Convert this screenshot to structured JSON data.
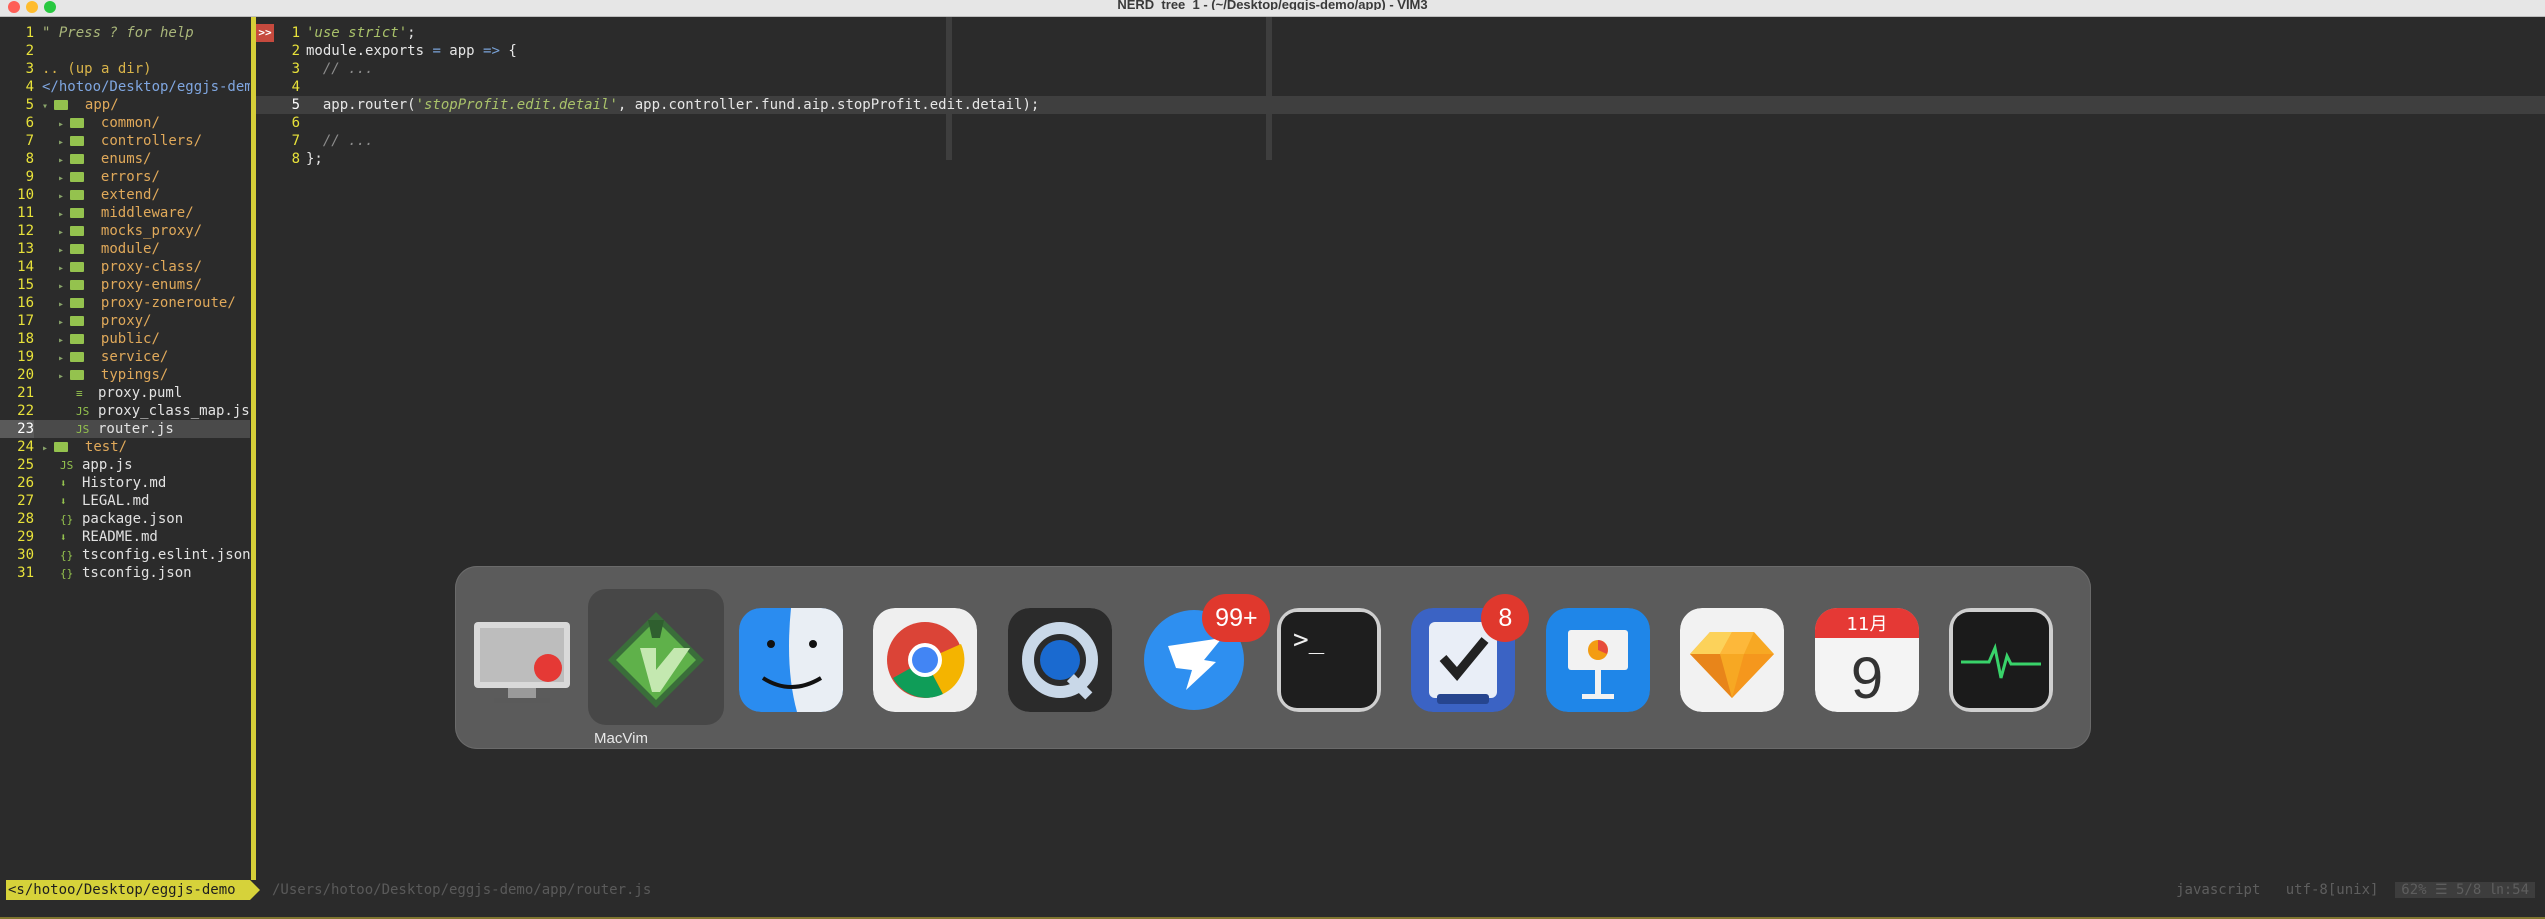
{
  "window": {
    "title": "NERD_tree_1 - (~/Desktop/eggjs-demo/app) - VIM3"
  },
  "nerdtree": {
    "lines": [
      {
        "n": "1",
        "text": "\" Press ? for help",
        "kind": "help"
      },
      {
        "n": "2",
        "text": "",
        "kind": "blank"
      },
      {
        "n": "3",
        "text": ".. (up a dir)",
        "kind": "updir"
      },
      {
        "n": "4",
        "text": "</hotoo/Desktop/eggjs-demo/",
        "kind": "root"
      },
      {
        "n": "5",
        "text": "app/",
        "kind": "dir",
        "depth": 1,
        "open": true
      },
      {
        "n": "6",
        "text": "common/",
        "kind": "dir",
        "depth": 2
      },
      {
        "n": "7",
        "text": "controllers/",
        "kind": "dir",
        "depth": 2
      },
      {
        "n": "8",
        "text": "enums/",
        "kind": "dir",
        "depth": 2
      },
      {
        "n": "9",
        "text": "errors/",
        "kind": "dir",
        "depth": 2
      },
      {
        "n": "10",
        "text": "extend/",
        "kind": "dir",
        "depth": 2
      },
      {
        "n": "11",
        "text": "middleware/",
        "kind": "dir",
        "depth": 2
      },
      {
        "n": "12",
        "text": "mocks_proxy/",
        "kind": "dir",
        "depth": 2
      },
      {
        "n": "13",
        "text": "module/",
        "kind": "dir",
        "depth": 2
      },
      {
        "n": "14",
        "text": "proxy-class/",
        "kind": "dir",
        "depth": 2
      },
      {
        "n": "15",
        "text": "proxy-enums/",
        "kind": "dir",
        "depth": 2
      },
      {
        "n": "16",
        "text": "proxy-zoneroute/",
        "kind": "dir",
        "depth": 2
      },
      {
        "n": "17",
        "text": "proxy/",
        "kind": "dir",
        "depth": 2
      },
      {
        "n": "18",
        "text": "public/",
        "kind": "dir",
        "depth": 2
      },
      {
        "n": "19",
        "text": "service/",
        "kind": "dir",
        "depth": 2
      },
      {
        "n": "20",
        "text": "typings/",
        "kind": "dir",
        "depth": 2
      },
      {
        "n": "21",
        "text": "proxy.puml",
        "kind": "file",
        "depth": 2,
        "icon": "≡"
      },
      {
        "n": "22",
        "text": "proxy_class_map.js",
        "kind": "file",
        "depth": 2,
        "icon": "JS"
      },
      {
        "n": "23",
        "text": "router.js",
        "kind": "file",
        "depth": 2,
        "icon": "JS",
        "current": true
      },
      {
        "n": "24",
        "text": "test/",
        "kind": "dir",
        "depth": 1
      },
      {
        "n": "25",
        "text": "app.js",
        "kind": "file",
        "depth": 1,
        "icon": "JS"
      },
      {
        "n": "26",
        "text": "History.md",
        "kind": "file",
        "depth": 1,
        "icon": "⬇"
      },
      {
        "n": "27",
        "text": "LEGAL.md",
        "kind": "file",
        "depth": 1,
        "icon": "⬇"
      },
      {
        "n": "28",
        "text": "package.json",
        "kind": "file",
        "depth": 1,
        "icon": "{}"
      },
      {
        "n": "29",
        "text": "README.md",
        "kind": "file",
        "depth": 1,
        "icon": "⬇"
      },
      {
        "n": "30",
        "text": "tsconfig.eslint.json",
        "kind": "file",
        "depth": 1,
        "icon": "{}"
      },
      {
        "n": "31",
        "text": "tsconfig.json",
        "kind": "file",
        "depth": 1,
        "icon": "{}"
      }
    ]
  },
  "editor": {
    "sign": ">>",
    "lines": [
      {
        "n": "1",
        "parts": [
          [
            "str",
            "'use strict'"
          ],
          [
            "txt",
            ";"
          ]
        ]
      },
      {
        "n": "2",
        "parts": [
          [
            "txt",
            "module.exports "
          ],
          [
            "op",
            "="
          ],
          [
            "txt",
            " app "
          ],
          [
            "op",
            "=>"
          ],
          [
            "txt",
            " {"
          ]
        ]
      },
      {
        "n": "3",
        "parts": [
          [
            "com",
            "  // ..."
          ]
        ]
      },
      {
        "n": "4",
        "parts": []
      },
      {
        "n": "5",
        "parts": [
          [
            "txt",
            "  app.router("
          ],
          [
            "str",
            "'stopProfit.edit.detail'"
          ],
          [
            "txt",
            ", app.controller.fund.aip.stopProfit.edit.detail);"
          ]
        ],
        "current": true
      },
      {
        "n": "6",
        "parts": []
      },
      {
        "n": "7",
        "parts": [
          [
            "com",
            "  // ..."
          ]
        ]
      },
      {
        "n": "8",
        "parts": [
          [
            "txt",
            "};"
          ]
        ]
      }
    ]
  },
  "statusline": {
    "left": "<s/hotoo/Desktop/eggjs-demo",
    "path": "/Users/hotoo/Desktop/eggjs-demo/app/router.js",
    "filetype": "javascript",
    "encoding": "utf-8[unix]",
    "position": "62% ☰ 5/8 ㏑:54"
  },
  "switcher": {
    "selected_label": "MacVim",
    "apps": [
      {
        "name": "screen-recorder-icon"
      },
      {
        "name": "macvim-icon",
        "selected": true
      },
      {
        "name": "finder-icon"
      },
      {
        "name": "chrome-icon"
      },
      {
        "name": "quicktime-icon"
      },
      {
        "name": "dingtalk-icon",
        "badge": "99+"
      },
      {
        "name": "terminal-icon",
        "glyph": ">_"
      },
      {
        "name": "omnifocus-icon",
        "badge": "8"
      },
      {
        "name": "keynote-icon"
      },
      {
        "name": "sketch-icon"
      },
      {
        "name": "calendar-icon",
        "month": "11月",
        "day": "9"
      },
      {
        "name": "activity-monitor-icon"
      }
    ]
  }
}
